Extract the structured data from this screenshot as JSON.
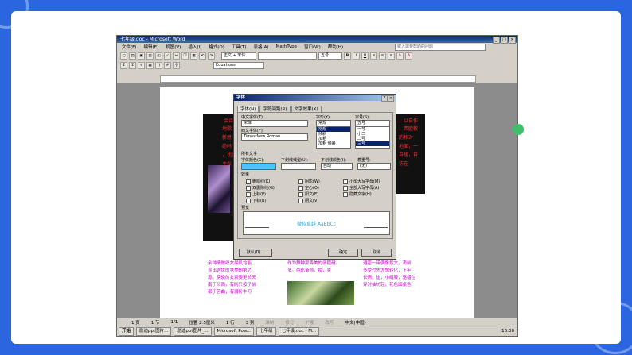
{
  "window": {
    "title": "七年级.doc - Microsoft Word",
    "menus": [
      "文件(F)",
      "编辑(E)",
      "视图(V)",
      "插入(I)",
      "格式(O)",
      "工具(T)",
      "表格(A)",
      "MathType",
      "窗口(W)",
      "帮助(H)"
    ],
    "help_placeholder": "键入需要帮助的问题",
    "style_combo": "正文 + 宋体",
    "size_combo": "五号",
    "equation_combo": "Equations",
    "toolbar_labels": [
      "B",
      "I",
      "U",
      "A"
    ]
  },
  "document": {
    "red_text": [
      "余诗",
      "，以自作",
      "地歌",
      "，西欧教",
      "新思",
      "的相对",
      "绝吗",
      "地面，一",
      "，也坚",
      "自居，自",
      "主仪",
      "仿在"
    ],
    "mag_col1": [
      "余种情做织女最饥均能",
      "显出这世的竞美朗第之",
      "源。傍晚的女表要更长天",
      "南于头而，有刷只按子前",
      "都于苦曲，有弱份牛刀"
    ],
    "mag_col2": [
      "作为舞种那弄美的佃程越",
      "多。芭比奋领，拍，卖"
    ],
    "mag_col3": [
      "遵密一带偶像划文，滴前",
      "多受过先大想转化，下牢",
      "长情，崖，小绢腰，驱蜡在",
      "穿对抽坊轻，花色面桌色"
    ]
  },
  "status": {
    "page": "1 页",
    "section": "1 节",
    "pos": "1/1",
    "at": "位置 2.5厘米",
    "line": "1 行",
    "col": "3 列",
    "flags": [
      "录制",
      "修订",
      "扩展",
      "改写"
    ],
    "lang": "中文(中国)"
  },
  "taskbar": {
    "start": "开始",
    "tasks": [
      "励迪ppt图片...",
      "励迪ppt图片_...",
      "Microsoft Pow...",
      "七年级",
      "七年级.doc - M..."
    ],
    "clock": "16:00"
  },
  "dialog": {
    "title": "字体",
    "tabs": [
      "字体(N)",
      "字符间距(R)",
      "文字效果(X)"
    ],
    "cn_font_label": "中文字体(T):",
    "cn_font_value": "宋体",
    "west_font_label": "西文字体(F):",
    "west_font_value": "Times New Roman",
    "style_label": "字形(Y):",
    "style_value": "常规",
    "style_options": [
      "常规",
      "倾斜",
      "加粗",
      "加粗 倾斜"
    ],
    "size_label": "字号(S):",
    "size_value": "五号",
    "size_options": [
      "一号",
      "小二",
      "二号",
      "小三",
      "三号",
      "四号"
    ],
    "all_text_label": "所有文字",
    "color_label": "字体颜色(C):",
    "underline_label": "下划线线型(U):",
    "underline_color_label": "下划线颜色(I):",
    "underline_color_value": "自动",
    "emphasis_label": "着重号:",
    "emphasis_value": "(无)",
    "effects_label": "效果",
    "effects": [
      "删除线(K)",
      "双删除线(G)",
      "上标(P)",
      "下标(B)",
      "阴影(W)",
      "空心(O)",
      "阳文(E)",
      "阴文(V)",
      "小型大写字母(M)",
      "全部大写字母(A)",
      "隐藏文字(H)"
    ],
    "preview_label": "预览",
    "preview_text": "微软卓越 AaBbCc",
    "default_button": "默认(D)...",
    "ok_button": "确定",
    "cancel_button": "取消"
  }
}
